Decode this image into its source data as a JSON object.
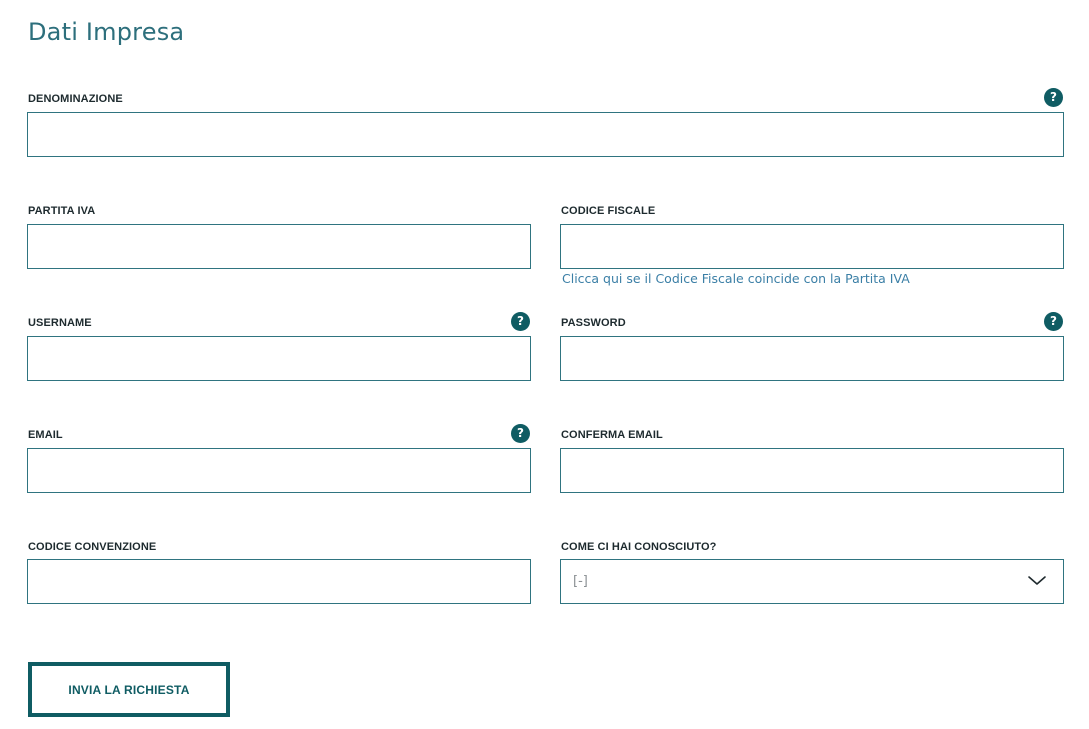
{
  "page": {
    "title": "Dati Impresa"
  },
  "form": {
    "denominazione": {
      "label": "DENOMINAZIONE",
      "value": ""
    },
    "partita_iva": {
      "label": "PARTITA IVA",
      "value": ""
    },
    "codice_fiscale": {
      "label": "CODICE FISCALE",
      "value": "",
      "hint": "Clicca qui se il Codice Fiscale coincide con la Partita IVA"
    },
    "username": {
      "label": "USERNAME",
      "value": ""
    },
    "password": {
      "label": "PASSWORD",
      "value": ""
    },
    "email": {
      "label": "EMAIL",
      "value": ""
    },
    "conferma_email": {
      "label": "CONFERMA EMAIL",
      "value": ""
    },
    "codice_convenzione": {
      "label": "CODICE CONVENZIONE",
      "value": ""
    },
    "come_ci_hai_conosciuto": {
      "label": "COME CI HAI CONOSCIUTO?",
      "selected": "[-]"
    },
    "help_icon_glyph": "?",
    "submit_label": "INVIA LA RICHIESTA"
  },
  "colors": {
    "title": "#2d6f7c",
    "accent": "#0f5c63",
    "input_border": "#2f7480",
    "link": "#3b7fa6"
  },
  "icons": {
    "help": "question-circle-icon",
    "dropdown": "chevron-down-icon"
  }
}
